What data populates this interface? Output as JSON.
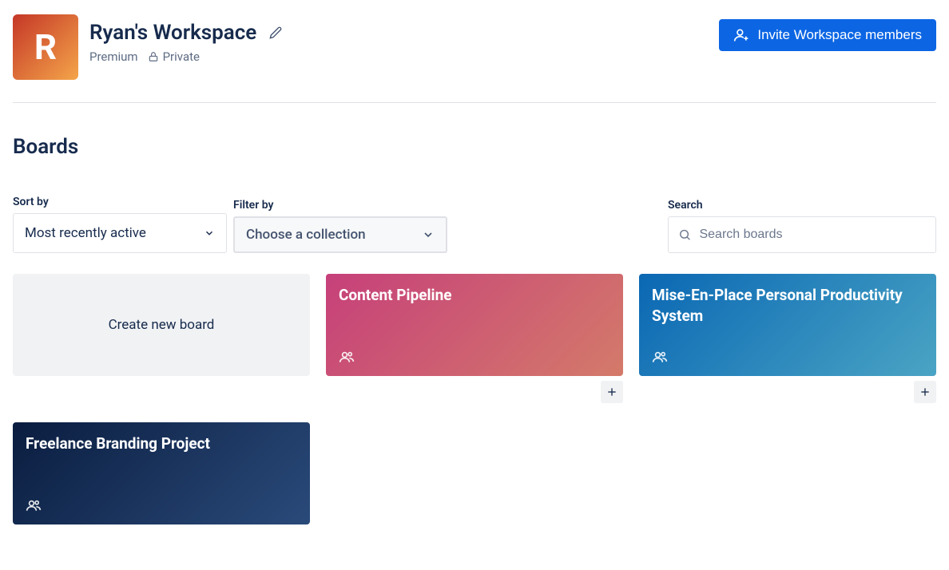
{
  "workspace": {
    "initial": "R",
    "name": "Ryan's Workspace",
    "premium_label": "Premium",
    "privacy_label": "Private"
  },
  "invite_label": "Invite Workspace members",
  "section_title": "Boards",
  "controls": {
    "sort_label": "Sort by",
    "sort_value": "Most recently active",
    "filter_label": "Filter by",
    "filter_value": "Choose a collection",
    "search_label": "Search",
    "search_placeholder": "Search boards"
  },
  "create_label": "Create new board",
  "boards": [
    {
      "title": "Content Pipeline"
    },
    {
      "title": "Mise-En-Place Personal Productivity System"
    },
    {
      "title": "Freelance Branding Project"
    }
  ]
}
